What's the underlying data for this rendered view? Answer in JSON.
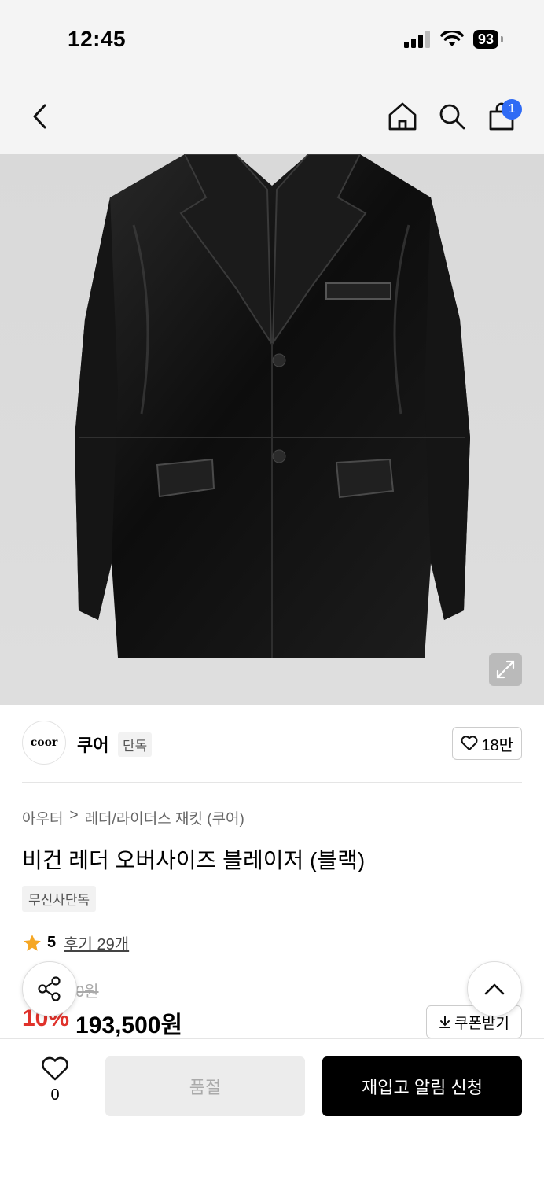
{
  "status_bar": {
    "time": "12:45",
    "battery": "93"
  },
  "nav": {
    "cart_count": "1"
  },
  "brand": {
    "logo_text": "coor",
    "name": "쿠어",
    "exclusive_tag": "단독",
    "like_count": "18만"
  },
  "breadcrumb": {
    "category": "아우터",
    "separator": ">",
    "subcategory": "레더/라이더스 재킷 (쿠어)"
  },
  "product": {
    "title": "비건 레더 오버사이즈 블레이저 (블랙)",
    "musinsa_tag": "무신사단독",
    "rating": "5",
    "review_label": "후기 29개",
    "original_price": "0원",
    "discount": "10%",
    "price": "193,500원",
    "coupon_label": "쿠폰받기"
  },
  "bottom_bar": {
    "wish_count": "0",
    "soldout_label": "품절",
    "restock_label": "재입고 알림 신청"
  }
}
